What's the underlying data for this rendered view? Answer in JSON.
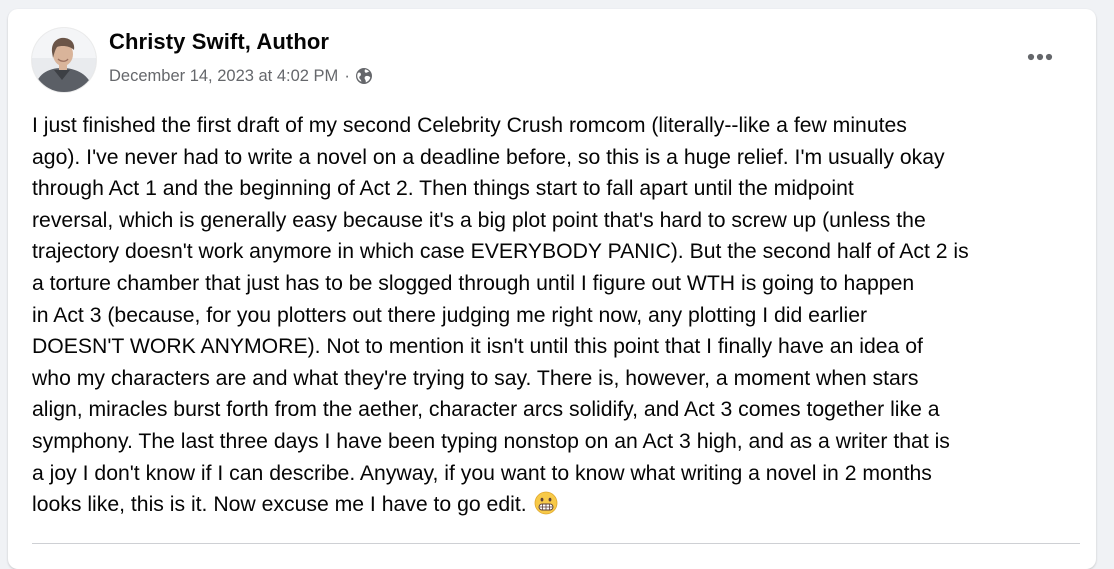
{
  "post": {
    "author": "Christy Swift, Author",
    "timestamp": "December 14, 2023 at 4:02 PM",
    "separator": "·",
    "privacy_icon": "globe-icon",
    "more_icon": "more-horizontal-icon",
    "text": "I just finished the first draft of my second Celebrity Crush romcom (literally--like a few minutes\nago). I've never had to write a novel on a deadline before, so this is a huge relief. I'm usually okay\nthrough Act 1 and the beginning of Act 2. Then things start to fall apart until the midpoint\nreversal, which is generally easy because it's a big plot point that's hard to screw up (unless the\ntrajectory doesn't work anymore in which case EVERYBODY PANIC). But the second half of Act 2 is\na torture chamber that just has to be slogged through until I figure out WTH is going to happen\nin Act 3 (because, for you plotters out there judging me right now, any plotting I did earlier\nDOESN'T WORK ANYMORE).  Not to mention it isn't until this point that I finally have an idea of\nwho my characters are and what they're trying to say. There is, however, a moment when stars\nalign, miracles burst forth from the aether, character arcs solidify, and Act 3 comes together like a\nsymphony. The last three days I have been typing nonstop on an Act 3 high, and as a writer that is\na joy I don't know if I can describe. Anyway, if you want to know what writing a novel in 2 months\nlooks like, this is it. Now excuse me I have to go edit. ",
    "emoji": "grimacing-face-emoji"
  },
  "colors": {
    "background": "#f0f2f5",
    "card": "#ffffff",
    "primary_text": "#050505",
    "secondary_text": "#65676b",
    "divider": "#ced0d4"
  }
}
